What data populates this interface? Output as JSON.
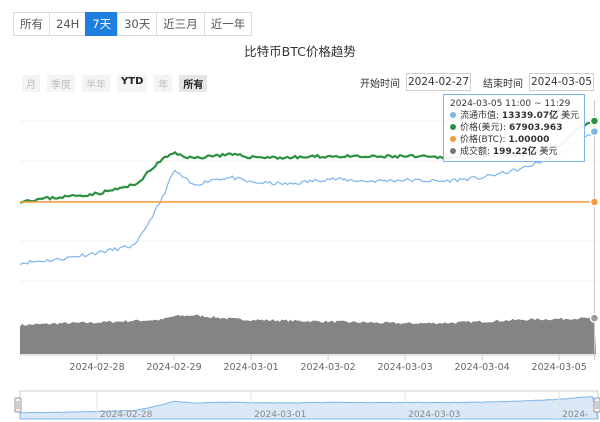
{
  "range_tabs": [
    {
      "label": "所有",
      "active": false
    },
    {
      "label": "24H",
      "active": false
    },
    {
      "label": "7天",
      "active": true
    },
    {
      "label": "30天",
      "active": false
    },
    {
      "label": "近三月",
      "active": false
    },
    {
      "label": "近一年",
      "active": false
    }
  ],
  "zoom_buttons": [
    {
      "label": "月",
      "state": "disabled"
    },
    {
      "label": "季度",
      "state": "disabled"
    },
    {
      "label": "半年",
      "state": "disabled"
    },
    {
      "label": "YTD",
      "state": "enabled"
    },
    {
      "label": "年",
      "state": "disabled"
    },
    {
      "label": "所有",
      "state": "active"
    }
  ],
  "date_range": {
    "start_label": "开始时间",
    "start_value": "2024-02-27",
    "end_label": "结束时间",
    "end_value": "2024-03-05"
  },
  "tooltip": {
    "header": "2024-03-05 11:00 ~ 11:29",
    "rows": [
      {
        "label": "流通市值:",
        "value": "13339.07亿",
        "unit": "美元",
        "color": "#7cb5ec"
      },
      {
        "label": "价格(美元):",
        "value": "67903.963",
        "unit": "",
        "color": "#2a9142"
      },
      {
        "label": "价格(BTC):",
        "value": "1.00000",
        "unit": "",
        "color": "#f49b3c"
      },
      {
        "label": "成交额:",
        "value": "199.22亿",
        "unit": "美元",
        "color": "#777777"
      }
    ]
  },
  "colors": {
    "market_cap": "#7cb5ec",
    "price_usd": "#2a9142",
    "price_btc": "#f49b3c",
    "volume": "#7d7d7d",
    "navigator_fill": "#dbe8f7",
    "navigator_line": "#7cb5ec",
    "accent": "#1e7fe0"
  },
  "chart_data": {
    "type": "line",
    "title": "比特币BTC价格趋势",
    "x_labels": [
      "2024-02-28",
      "2024-02-29",
      "2024-03-01",
      "2024-03-02",
      "2024-03-03",
      "2024-03-04",
      "2024-03-05"
    ],
    "navigator_labels": [
      "2024-02-28",
      "2024-03-01",
      "2024-03-03",
      "2024-"
    ],
    "x_range": [
      "2024-02-27",
      "2024-03-05 11:29"
    ],
    "x": [
      "2024-02-27 00:00",
      "2024-02-27 12:00",
      "2024-02-28 00:00",
      "2024-02-28 12:00",
      "2024-02-28 20:00",
      "2024-02-29 00:00",
      "2024-02-29 06:00",
      "2024-02-29 12:00",
      "2024-02-29 18:00",
      "2024-03-01 00:00",
      "2024-03-01 12:00",
      "2024-03-02 00:00",
      "2024-03-02 12:00",
      "2024-03-03 00:00",
      "2024-03-03 12:00",
      "2024-03-04 00:00",
      "2024-03-04 12:00",
      "2024-03-05 00:00",
      "2024-03-05 06:00",
      "2024-03-05 11:00"
    ],
    "series": [
      {
        "name": "流通市值",
        "unit": "亿美元",
        "values": [
          11170,
          11230,
          11340,
          11460,
          12200,
          12700,
          12450,
          12550,
          12580,
          12500,
          12470,
          12560,
          12520,
          12540,
          12520,
          12580,
          12720,
          12950,
          13200,
          13339.07
        ]
      },
      {
        "name": "价格(美元)",
        "unit": "美元",
        "values": [
          57000,
          57500,
          58000,
          59200,
          62600,
          63500,
          62800,
          63200,
          63300,
          63000,
          62900,
          63100,
          63000,
          63100,
          62900,
          63000,
          63200,
          64500,
          67000,
          67903.963
        ]
      },
      {
        "name": "价格(BTC)",
        "unit": "BTC",
        "values": [
          1,
          1,
          1,
          1,
          1,
          1,
          1,
          1,
          1,
          1,
          1,
          1,
          1,
          1,
          1,
          1,
          1,
          1,
          1,
          1
        ]
      },
      {
        "name": "成交额",
        "unit": "亿美元",
        "values": [
          160,
          170,
          175,
          185,
          190,
          210,
          215,
          205,
          195,
          190,
          185,
          180,
          175,
          170,
          172,
          180,
          190,
          195,
          198,
          199.22
        ]
      }
    ]
  }
}
